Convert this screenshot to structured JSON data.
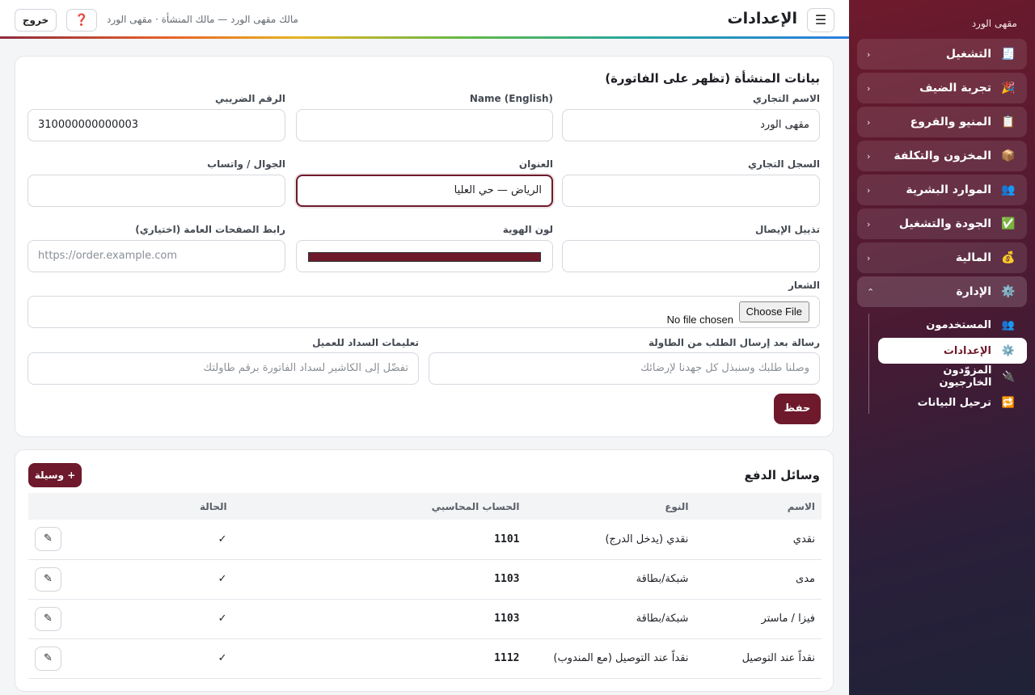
{
  "sidebar": {
    "brand": "مقهى الورد",
    "items": [
      {
        "icon": "🧾",
        "label": "التشغيل",
        "chev": "‹"
      },
      {
        "icon": "🎉",
        "label": "تجربة الضيف",
        "chev": "‹"
      },
      {
        "icon": "📋",
        "label": "المنيو والفروع",
        "chev": "‹"
      },
      {
        "icon": "📦",
        "label": "المخزون والتكلفة",
        "chev": "‹"
      },
      {
        "icon": "👥",
        "label": "الموارد البشرية",
        "chev": "‹"
      },
      {
        "icon": "✅",
        "label": "الجودة والتشغيل",
        "chev": "‹"
      },
      {
        "icon": "💰",
        "label": "المالية",
        "chev": "‹"
      },
      {
        "icon": "⚙️",
        "label": "الإدارة",
        "chev": "⌃"
      }
    ],
    "subitems": [
      {
        "icon": "👥",
        "label": "المستخدمون"
      },
      {
        "icon": "⚙️",
        "label": "الإعدادات"
      },
      {
        "icon": "🔌",
        "label": "المزوّدون الخارجيون"
      },
      {
        "icon": "🔁",
        "label": "ترحيل البيانات"
      }
    ]
  },
  "topbar": {
    "menu_icon": "☰",
    "title": "الإعدادات",
    "user_line": "مالك مقهى الورد — مالك المنشأة · مقهى الورد",
    "help_icon": "❓",
    "logout": "خروج"
  },
  "business": {
    "title": "بيانات المنشأة (تظهر على الفاتورة)",
    "trade_name_label": "الاسم التجاري",
    "trade_name_value": "مقهى الورد",
    "name_en_label": "Name (English)",
    "name_en_value": "",
    "tax_label": "الرقم الضريبي",
    "tax_value": "310000000000003",
    "cr_label": "السجل التجاري",
    "cr_value": "",
    "address_label": "العنوان",
    "address_value": "الرياض — حي العليا",
    "phone_label": "الجوال / واتساب",
    "phone_value": "",
    "footer_label": "تذييل الإيصال",
    "footer_value": "",
    "brand_color_label": "لون الهوية",
    "brand_color": "#6e1a2c",
    "public_url_label": "رابط الصفحات العامة (اختياري)",
    "public_url_placeholder": "https://order.example.com",
    "logo_label": "الشعار",
    "choose_file": "Choose File",
    "no_file": "No file chosen",
    "after_order_label": "رسالة بعد إرسال الطلب من الطاولة",
    "after_order_placeholder": "وصلنا طلبك وسنبذل كل جهدنا لإرضائك",
    "payment_instr_label": "تعليمات السداد للعميل",
    "payment_instr_placeholder": "تفضّل إلى الكاشير لسداد الفاتورة برقم طاولتك",
    "save": "حفظ"
  },
  "payments": {
    "title": "وسائل الدفع",
    "add": "+ وسيلة",
    "columns": [
      "الاسم",
      "النوع",
      "الحساب المحاسبي",
      "الحالة",
      ""
    ],
    "rows": [
      {
        "name": "نقدي",
        "type": "نقدي (يدخل الدرج)",
        "account": "1101",
        "status": "✓",
        "edit": "✎"
      },
      {
        "name": "مدى",
        "type": "شبكة/بطاقة",
        "account": "1103",
        "status": "✓",
        "edit": "✎"
      },
      {
        "name": "فيزا / ماستر",
        "type": "شبكة/بطاقة",
        "account": "1103",
        "status": "✓",
        "edit": "✎"
      },
      {
        "name": "نقداً عند التوصيل",
        "type": "نقداً عند التوصيل (مع المندوب)",
        "account": "1112",
        "status": "✓",
        "edit": "✎"
      }
    ]
  }
}
